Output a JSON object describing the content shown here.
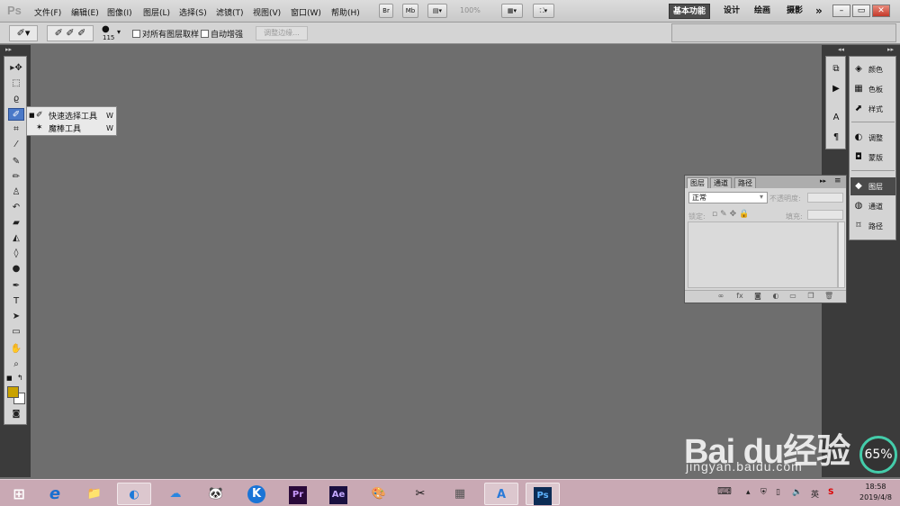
{
  "app": {
    "logo": "Ps"
  },
  "menu": {
    "items": [
      "文件(F)",
      "编辑(E)",
      "图像(I)",
      "图层(L)",
      "选择(S)",
      "滤镜(T)",
      "视图(V)",
      "窗口(W)",
      "帮助(H)"
    ],
    "bridge_button": "Br",
    "minibridge_button": "Mb",
    "zoom_level": "100%"
  },
  "workspaces": [
    "基本功能",
    "设计",
    "绘画",
    "摄影"
  ],
  "workspace_more": "»",
  "window_controls": {
    "minimize": "–",
    "restore": "▭",
    "close": "✕"
  },
  "options": {
    "brush_size": "115",
    "sample_all_layers": "对所有图层取样",
    "auto_enhance": "自动增强",
    "refine_edge": "调整边缘..."
  },
  "flyout": {
    "items": [
      {
        "label": "快速选择工具",
        "key": "W",
        "active": true
      },
      {
        "label": "魔棒工具",
        "key": "W",
        "active": false
      }
    ]
  },
  "dock": {
    "panels": [
      "颜色",
      "色板",
      "样式",
      "调整",
      "蒙版",
      "图层",
      "通道",
      "路径"
    ],
    "active": "图层"
  },
  "layers_panel": {
    "tabs": [
      "图层",
      "通道",
      "路径"
    ],
    "blend_mode": "正常",
    "opacity_label": "不透明度:",
    "lock_label": "锁定:",
    "fill_label": "填充:"
  },
  "watermark": {
    "brand": "Bai du经验",
    "url": "jingyan.baidu.com"
  },
  "speed_widget": {
    "value": "65%"
  },
  "taskbar": {
    "apps": [
      "e",
      "📁",
      "◐",
      "☁",
      "🐼",
      "K",
      "Pr",
      "Ae",
      "🎨",
      "✂",
      "▦",
      "A",
      "Ps"
    ],
    "tray_ime": "英",
    "time": "18:58",
    "date": "2019/4/8"
  },
  "colors": {
    "foreground": "#c9a200",
    "background": "#ffffff",
    "canvas": "#6e6e6e"
  }
}
